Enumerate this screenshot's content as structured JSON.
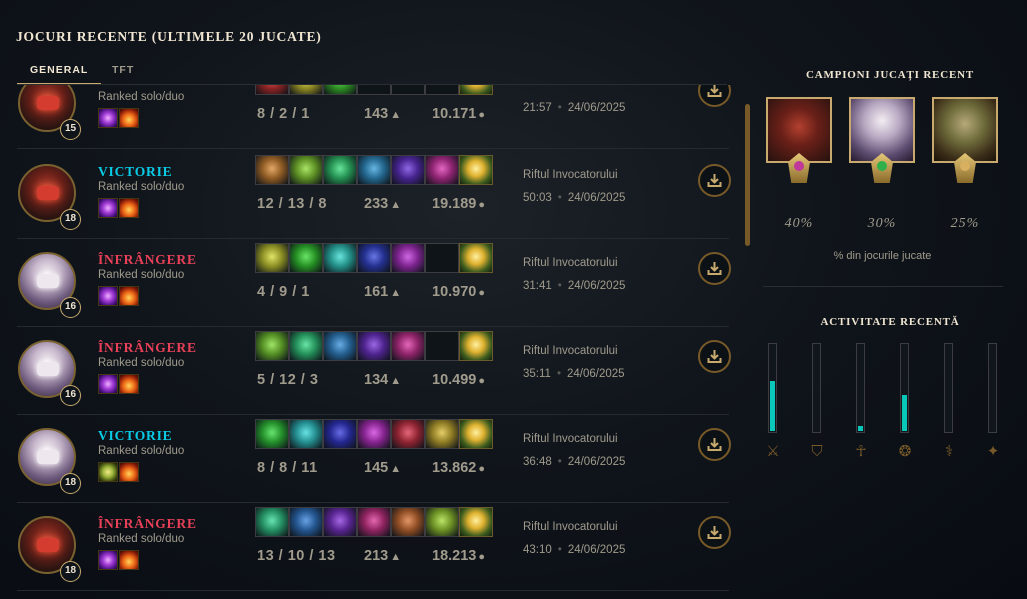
{
  "header": {
    "title": "JOCURI RECENTE (ULTIMELE 20 JUCATE)"
  },
  "tabs": [
    {
      "label": "GENERAL",
      "active": true
    },
    {
      "label": "TFT",
      "active": false
    }
  ],
  "games": [
    {
      "result": "",
      "queue": "Ranked solo/duo",
      "level": "15",
      "champion": "zed",
      "spells": [
        "purple",
        "ignite"
      ],
      "items": [
        "item",
        "item",
        "item",
        "empty",
        "empty",
        "empty",
        "trinket"
      ],
      "kda": "8 / 2 / 1",
      "cs": "143",
      "gold": "10.171",
      "map": "",
      "duration": "21:57",
      "date": "24/06/2025"
    },
    {
      "result": "VICTORIE",
      "outcome": "win",
      "queue": "Ranked solo/duo",
      "level": "18",
      "champion": "zed",
      "spells": [
        "purple",
        "ignite"
      ],
      "items": [
        "item",
        "item",
        "item",
        "item",
        "item",
        "item",
        "trinket"
      ],
      "kda": "12 / 13 / 8",
      "cs": "233",
      "gold": "19.189",
      "map": "Riftul Invocatorului",
      "duration": "50:03",
      "date": "24/06/2025"
    },
    {
      "result": "ÎNFRÂNGERE",
      "outcome": "loss",
      "queue": "Ranked solo/duo",
      "level": "16",
      "champion": "diana",
      "spells": [
        "purple",
        "ignite"
      ],
      "items": [
        "item",
        "item",
        "item",
        "item",
        "item",
        "empty",
        "trinket"
      ],
      "kda": "4 / 9 / 1",
      "cs": "161",
      "gold": "10.970",
      "map": "Riftul Invocatorului",
      "duration": "31:41",
      "date": "24/06/2025"
    },
    {
      "result": "ÎNFRÂNGERE",
      "outcome": "loss",
      "queue": "Ranked solo/duo",
      "level": "16",
      "champion": "diana",
      "spells": [
        "purple",
        "ignite"
      ],
      "items": [
        "item",
        "item",
        "item",
        "item",
        "item",
        "empty",
        "trinket"
      ],
      "kda": "5 / 12 / 3",
      "cs": "134",
      "gold": "10.499",
      "map": "Riftul Invocatorului",
      "duration": "35:11",
      "date": "24/06/2025"
    },
    {
      "result": "VICTORIE",
      "outcome": "win",
      "queue": "Ranked solo/duo",
      "level": "18",
      "champion": "diana",
      "spells": [
        "exhaust",
        "ignite"
      ],
      "items": [
        "item",
        "item",
        "item",
        "item",
        "item",
        "item",
        "trinket"
      ],
      "kda": "8 / 8 / 11",
      "cs": "145",
      "gold": "13.862",
      "map": "Riftul Invocatorului",
      "duration": "36:48",
      "date": "24/06/2025"
    },
    {
      "result": "ÎNFRÂNGERE",
      "outcome": "loss",
      "queue": "Ranked solo/duo",
      "level": "18",
      "champion": "zed",
      "spells": [
        "purple",
        "ignite"
      ],
      "items": [
        "item",
        "item",
        "item",
        "item",
        "item",
        "item",
        "trinket"
      ],
      "kda": "13 / 10 / 13",
      "cs": "213",
      "gold": "18.213",
      "map": "Riftul Invocatorului",
      "duration": "43:10",
      "date": "24/06/2025"
    }
  ],
  "recent_champions": {
    "title": "CAMPIONI JUCAȚI RECENT",
    "champions": [
      {
        "name": "zed",
        "pct": "40%",
        "gem": "#c0389a"
      },
      {
        "name": "diana",
        "pct": "30%",
        "gem": "#2fb04a"
      },
      {
        "name": "yorick",
        "pct": "25%",
        "gem": "#d8b060"
      }
    ],
    "caption": "% din jocurile jucate"
  },
  "recent_activity": {
    "title": "ACTIVITATE RECENTĂ",
    "bars": [
      {
        "role": "top",
        "fraction": 0.58
      },
      {
        "role": "jungle",
        "fraction": 0.0
      },
      {
        "role": "middle",
        "fraction": 0.06
      },
      {
        "role": "bottom",
        "fraction": 0.42
      },
      {
        "role": "support",
        "fraction": 0.0
      },
      {
        "role": "fill",
        "fraction": 0.0
      }
    ],
    "fill_color": "#0ac8b9"
  },
  "icons": {
    "download": "download-icon",
    "cs": "minion-icon",
    "gold": "gold-icon"
  }
}
